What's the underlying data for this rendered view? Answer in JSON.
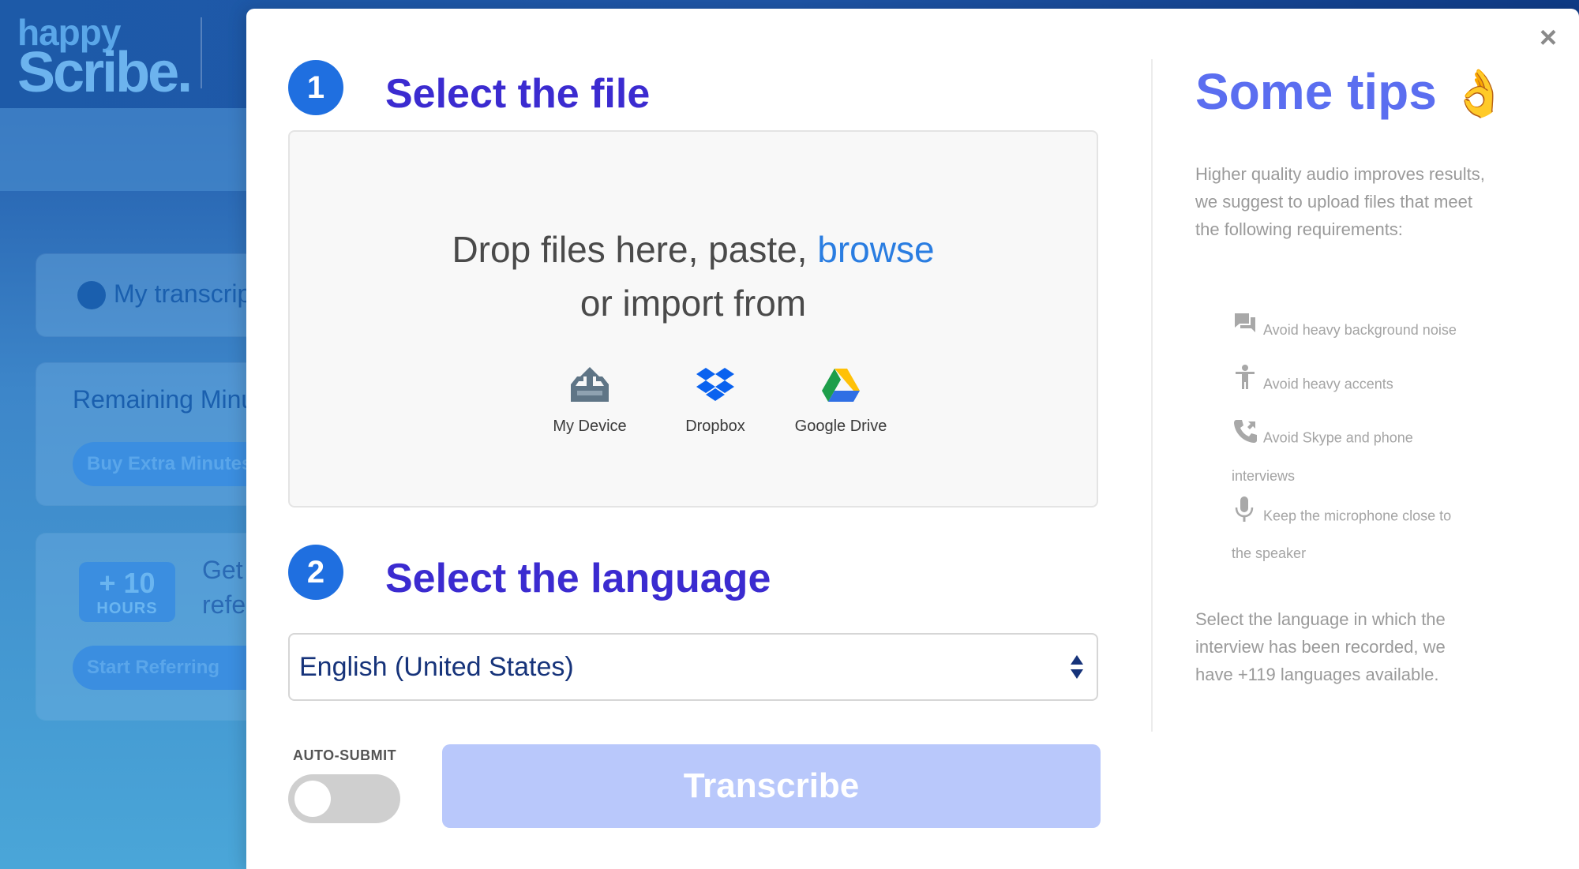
{
  "background": {
    "brand_line1": "happy",
    "brand_line2": "Scribe.",
    "my_transcriptions": "My transcrip",
    "remaining_minutes": "Remaining Minu",
    "buy_extra_minutes": "Buy Extra Minutes",
    "hours_badge_number": "+ 10",
    "hours_badge_unit": "HOURS",
    "referral_text_1": "Get",
    "referral_text_2": "refe",
    "start_referring": "Start Referring"
  },
  "modal": {
    "close_label": "×",
    "step1": {
      "number": "1",
      "title": "Select the file",
      "drop_text_prefix": "Drop files here, paste, ",
      "browse_label": "browse",
      "drop_text_line2": "or import from",
      "sources": [
        {
          "label": "My Device",
          "icon": "upload-tray-icon"
        },
        {
          "label": "Dropbox",
          "icon": "dropbox-icon"
        },
        {
          "label": "Google Drive",
          "icon": "google-drive-icon"
        }
      ]
    },
    "step2": {
      "number": "2",
      "title": "Select the language",
      "selected_language": "English (United States)"
    },
    "auto_submit_label": "AUTO-SUBMIT",
    "auto_submit_on": false,
    "transcribe_label": "Transcribe",
    "tips": {
      "title": "Some tips",
      "emoji": "👌",
      "intro": "Higher quality audio improves results, we suggest to upload files that meet the following requirements:",
      "items": [
        {
          "line1": "Avoid heavy background noise",
          "line2": "",
          "icon": "chat-bubbles-icon"
        },
        {
          "line1": "Avoid heavy accents",
          "line2": "",
          "icon": "person-icon"
        },
        {
          "line1": "Avoid Skype and phone",
          "line2": "interviews",
          "icon": "phone-icon"
        },
        {
          "line1": "Keep the microphone close to",
          "line2": "the speaker",
          "icon": "microphone-icon"
        }
      ],
      "outro": "Select the language in which the interview has been recorded, we have +119 languages available."
    }
  },
  "colors": {
    "step_circle": "#1f6fe0",
    "step_title": "#3b2bd0",
    "browse_link": "#2a7de1",
    "tips_title": "#5b6ef0",
    "transcribe_disabled": "#b9c8fb"
  }
}
